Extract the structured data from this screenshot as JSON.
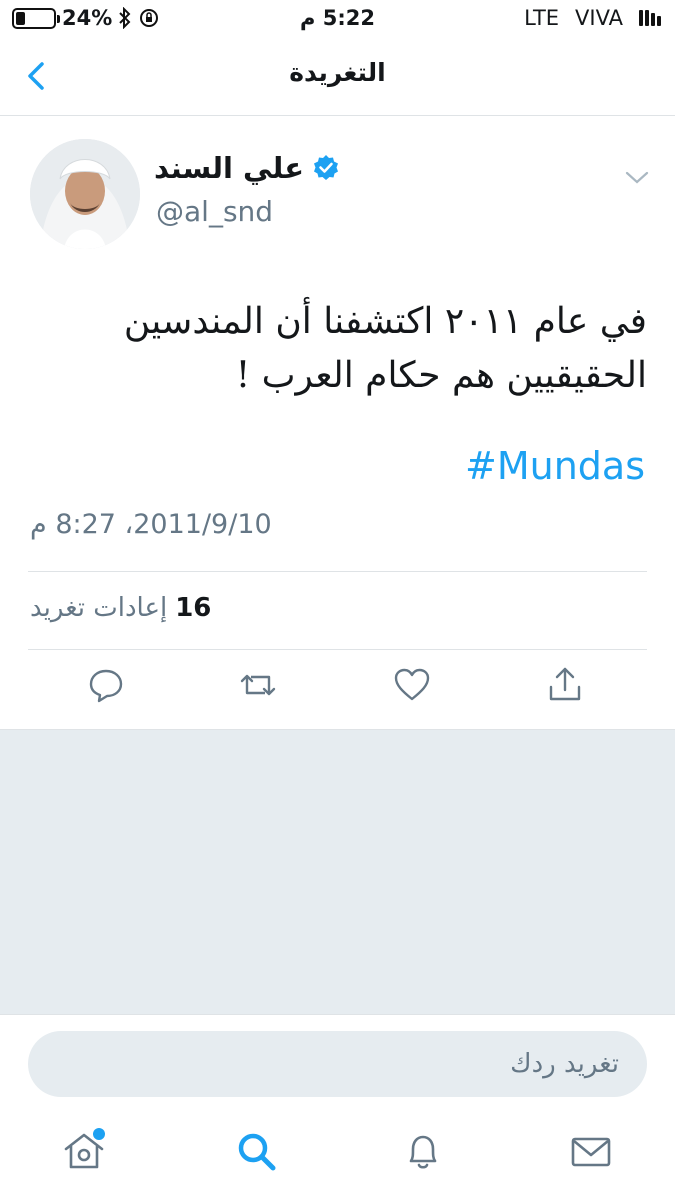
{
  "status_bar": {
    "battery": "24%",
    "battery_level": 0.24,
    "time": "5:22 م",
    "network": "LTE",
    "carrier": "VIVA"
  },
  "nav": {
    "title": "التغريدة"
  },
  "tweet": {
    "author_name": "علي السند",
    "handle": "@al_snd",
    "verified": true,
    "text": "في عام ٢٠١١ اكتشفنا أن المندسين الحقيقيين هم حكام العرب !",
    "hashtag": "#Mundas",
    "timestamp": "2011/9/10، 8:27 م",
    "retweet_count": "16",
    "retweet_label": "إعادات تغريد"
  },
  "reply": {
    "placeholder": "تغريد ردك"
  },
  "colors": {
    "accent": "#1da1f2",
    "secondary_text": "#657786",
    "background_gray": "#e6ecf0"
  },
  "icons": {
    "back": "chevron-left-icon",
    "verified": "verified-badge-icon",
    "menu": "chevron-down-icon",
    "reply": "reply-icon",
    "retweet": "retweet-icon",
    "like": "heart-icon",
    "share": "share-icon",
    "home": "home-icon",
    "search": "search-icon",
    "notifications": "bell-icon",
    "messages": "mail-icon"
  }
}
